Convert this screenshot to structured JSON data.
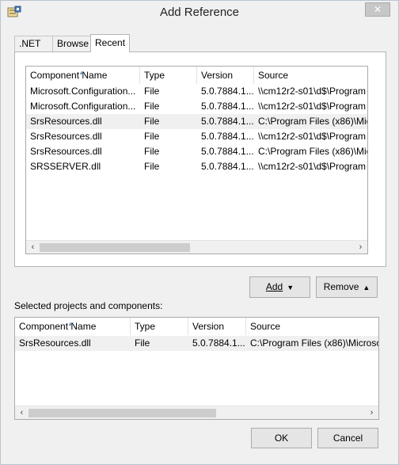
{
  "window": {
    "title": "Add Reference",
    "close_glyph": "✕"
  },
  "tabs": [
    {
      "label": ".NET"
    },
    {
      "label": "Browse"
    },
    {
      "label": "Recent"
    }
  ],
  "recent_list": {
    "columns": [
      "Component Name",
      "Type",
      "Version",
      "Source"
    ],
    "rows": [
      [
        "Microsoft.Configuration...",
        "File",
        "5.0.7884.1...",
        "\\\\cm12r2-s01\\d$\\Program"
      ],
      [
        "Microsoft.Configuration...",
        "File",
        "5.0.7884.1...",
        "\\\\cm12r2-s01\\d$\\Program"
      ],
      [
        "SrsResources.dll",
        "File",
        "5.0.7884.1...",
        "C:\\Program Files (x86)\\Mic"
      ],
      [
        "SrsResources.dll",
        "File",
        "5.0.7884.1...",
        "\\\\cm12r2-s01\\d$\\Program"
      ],
      [
        "SrsResources.dll",
        "File",
        "5.0.7884.1...",
        "C:\\Program Files (x86)\\Mic"
      ],
      [
        "SRSSERVER.dll",
        "File",
        "5.0.7884.1...",
        "\\\\cm12r2-s01\\d$\\Program"
      ]
    ],
    "selected_row": 2
  },
  "actions": {
    "add_label": "Add",
    "add_glyph": "▼",
    "remove_label": "Remove",
    "remove_glyph": "▲"
  },
  "selected": {
    "label": "Selected projects and components:",
    "columns": [
      "Component Name",
      "Type",
      "Version",
      "Source"
    ],
    "rows": [
      [
        "SrsResources.dll",
        "File",
        "5.0.7884.1...",
        "C:\\Program Files (x86)\\Microso"
      ]
    ]
  },
  "footer": {
    "ok_label": "OK",
    "cancel_label": "Cancel"
  },
  "scroll_glyphs": {
    "left": "‹",
    "right": "›"
  }
}
